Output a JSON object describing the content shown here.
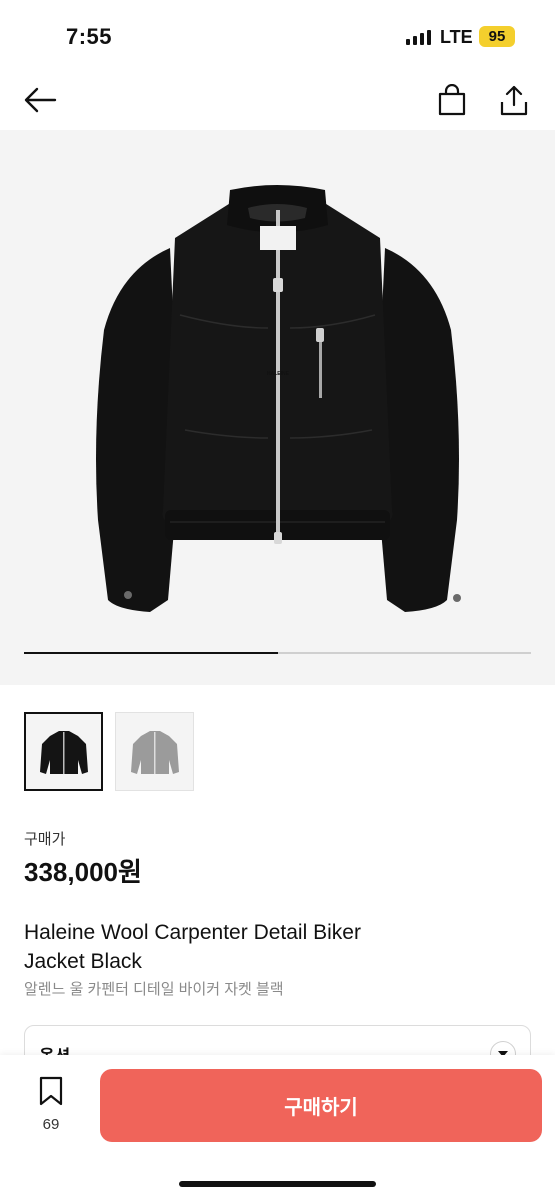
{
  "status": {
    "time": "7:55",
    "network": "LTE",
    "battery": "95",
    "battery_color": "#f4cf2d"
  },
  "nav": {
    "back_icon": "arrow-left-icon",
    "bag_icon": "shopping-bag-icon",
    "share_icon": "share-icon"
  },
  "gallery": {
    "jacket_brand_tag": "HALEINE",
    "progress": 0.5,
    "thumbnails": [
      "black-jacket",
      "grey-jacket"
    ],
    "selected": 0
  },
  "product": {
    "price_label": "구매가",
    "price": "338,000원",
    "title_line1": "Haleine Wool Carpenter Detail Biker",
    "title_line2": "Jacket Black",
    "subtitle": "알렌느 울 카펜터 디테일 바이커 자켓 블랙"
  },
  "options": {
    "label": "옵션"
  },
  "bottom": {
    "bookmark_count": "69",
    "buy_label": "구매하기",
    "buy_color": "#f0645a"
  }
}
